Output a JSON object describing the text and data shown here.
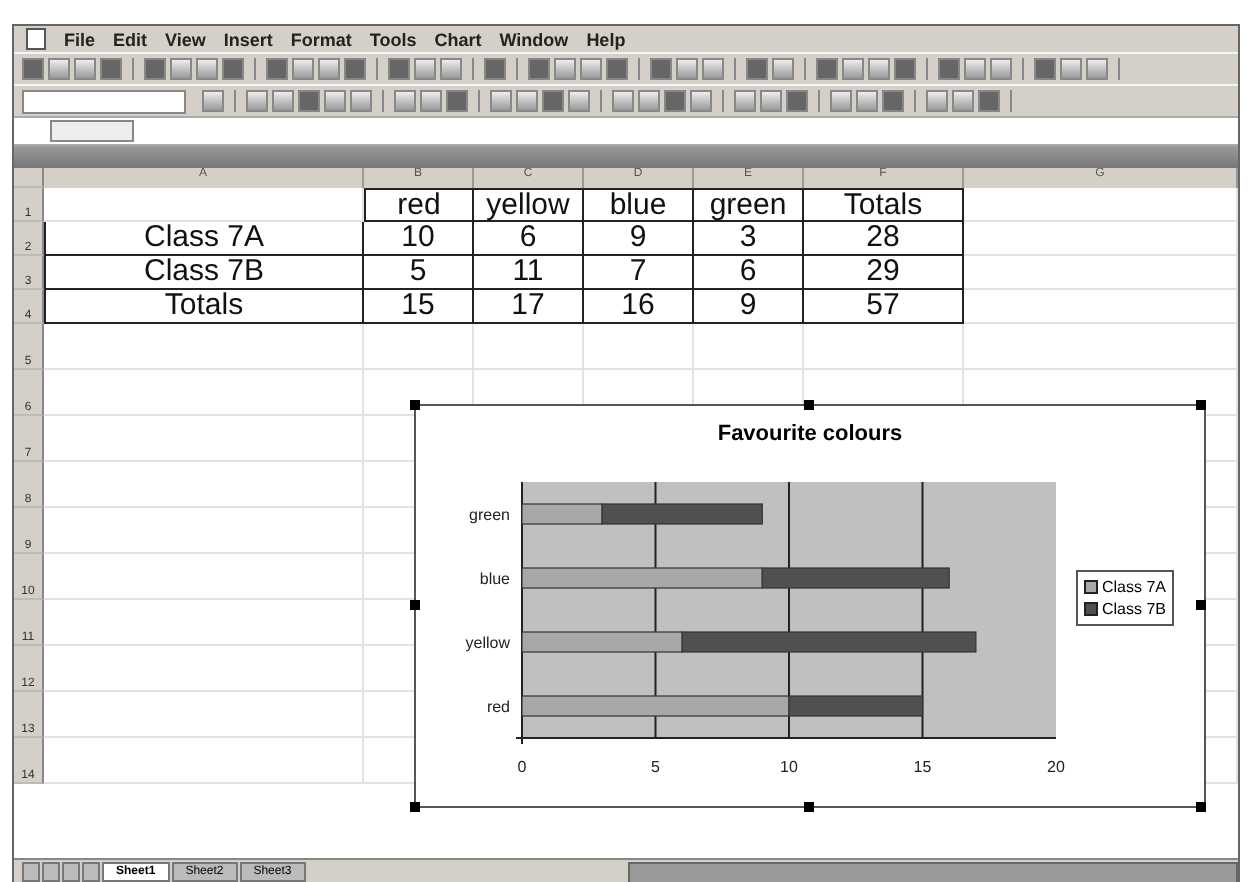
{
  "menu_bar": [
    "File",
    "Edit",
    "View",
    "Insert",
    "Format",
    "Tools",
    "Chart",
    "Window",
    "Help"
  ],
  "column_letters": [
    "A",
    "B",
    "C",
    "D",
    "E",
    "F",
    "G"
  ],
  "row_numbers": [
    "1",
    "2",
    "3",
    "4",
    "5",
    "6",
    "7",
    "8",
    "9",
    "10",
    "11",
    "12",
    "13",
    "14"
  ],
  "table": {
    "columns": [
      "red",
      "yellow",
      "blue",
      "green",
      "Totals"
    ],
    "rows": [
      {
        "name": "Class 7A",
        "values": [
          "10",
          "6",
          "9",
          "3",
          "28"
        ]
      },
      {
        "name": "Class 7B",
        "values": [
          "5",
          "11",
          "7",
          "6",
          "29"
        ]
      },
      {
        "name": "Totals",
        "values": [
          "15",
          "17",
          "16",
          "9",
          "57"
        ]
      }
    ]
  },
  "chart": {
    "chart_data": {
      "type": "bar",
      "orientation": "horizontal",
      "stacked": true,
      "title": "Favourite colours",
      "categories": [
        "green",
        "blue",
        "yellow",
        "red"
      ],
      "series": [
        {
          "name": "Class 7A",
          "color": "#a8a8a8",
          "values": [
            3,
            9,
            6,
            10
          ]
        },
        {
          "name": "Class 7B",
          "color": "#505050",
          "values": [
            6,
            7,
            11,
            5
          ]
        }
      ],
      "xlim": [
        0,
        20
      ],
      "xticks": [
        0,
        5,
        10,
        15,
        20
      ],
      "grid": true,
      "legend": true
    }
  },
  "sheet_tabs": [
    {
      "label": "Sheet1",
      "selected": true
    },
    {
      "label": "Sheet2",
      "selected": false
    },
    {
      "label": "Sheet3",
      "selected": false
    }
  ]
}
